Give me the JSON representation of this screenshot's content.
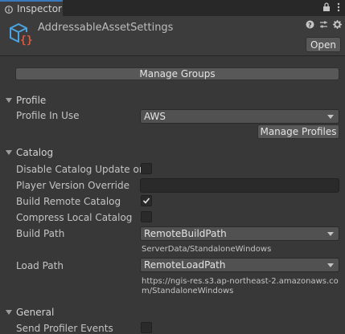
{
  "tab": {
    "title": "Inspector"
  },
  "header": {
    "asset_name": "AddressableAssetSettings",
    "open_label": "Open"
  },
  "manage_groups_label": "Manage Groups",
  "profile": {
    "section_label": "Profile",
    "profile_in_use_label": "Profile In Use",
    "profile_in_use_value": "AWS",
    "manage_profiles_label": "Manage Profiles"
  },
  "catalog": {
    "section_label": "Catalog",
    "disable_update_label": "Disable Catalog Update on",
    "disable_update_checked": false,
    "player_version_label": "Player Version Override",
    "player_version_value": "",
    "build_remote_label": "Build Remote Catalog",
    "build_remote_checked": true,
    "compress_local_label": "Compress Local Catalog",
    "compress_local_checked": false,
    "build_path_label": "Build Path",
    "build_path_value": "RemoteBuildPath",
    "build_path_resolved": "ServerData/StandaloneWindows",
    "load_path_label": "Load Path",
    "load_path_value": "RemoteLoadPath",
    "load_path_resolved": "https://ngis-res.s3.ap-northeast-2.amazonaws.com/StandaloneWindows"
  },
  "general": {
    "section_label": "General",
    "send_profiler_label": "Send Profiler Events",
    "send_profiler_checked": false
  },
  "colors": {
    "background": "#383838",
    "tab_accent": "#3a79bb",
    "asset_icon_blue": "#4aa3e0",
    "asset_icon_red": "#e0563c"
  }
}
